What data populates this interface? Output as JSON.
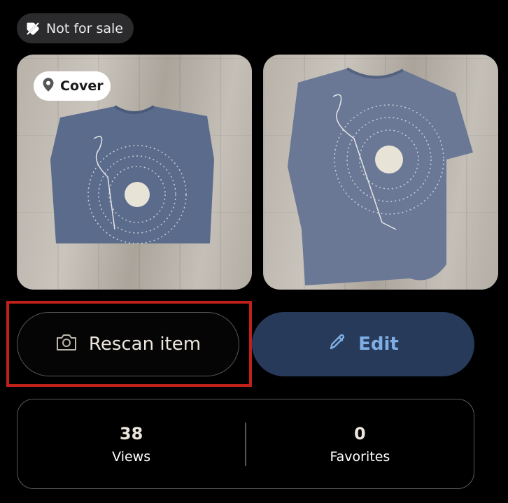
{
  "status": {
    "label": "Not for sale",
    "icon": "tag-off-icon"
  },
  "photos": [
    {
      "badge": "Cover",
      "badge_icon": "location-pin-icon"
    },
    {
      "badge": ""
    }
  ],
  "actions": {
    "rescan_label": "Rescan item",
    "rescan_icon": "camera-icon",
    "edit_label": "Edit",
    "edit_icon": "pencil-icon"
  },
  "stats": {
    "views_value": "38",
    "views_label": "Views",
    "favorites_value": "0",
    "favorites_label": "Favorites"
  },
  "colors": {
    "background": "#000000",
    "edit_button": "#273a5a",
    "edit_text": "#7eaee4",
    "highlight": "#c0201a"
  }
}
